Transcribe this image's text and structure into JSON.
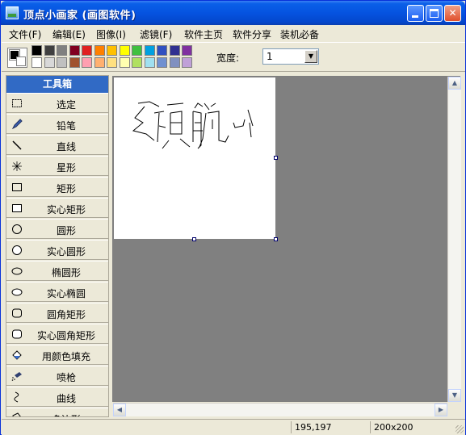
{
  "window": {
    "title": "顶点小画家 (画图软件)"
  },
  "menu": [
    {
      "label": "文件(F)"
    },
    {
      "label": "编辑(E)"
    },
    {
      "label": "图像(I)"
    },
    {
      "label": "滤镜(F)"
    },
    {
      "label": "软件主页"
    },
    {
      "label": "软件分享"
    },
    {
      "label": "装机必备"
    }
  ],
  "toolbar": {
    "foreground_color": "#000000",
    "background_color": "#ffffff",
    "palette_row1": [
      "#000000",
      "#404040",
      "#808080",
      "#800020",
      "#e02020",
      "#ff8000",
      "#ffc000",
      "#ffff00",
      "#40c040",
      "#00a0e0",
      "#3050c0",
      "#303090",
      "#8030a0"
    ],
    "palette_row2": [
      "#ffffff",
      "#d8d8d8",
      "#c0c0c0",
      "#a0522d",
      "#ff9fb0",
      "#ffb070",
      "#ffe080",
      "#ffffb0",
      "#b0e060",
      "#a0e0f0",
      "#7090d0",
      "#8090c0",
      "#c0a0d8"
    ],
    "width_label": "宽度:",
    "width_value": "1"
  },
  "toolbox": {
    "header": "工具箱",
    "tools": [
      {
        "label": "选定",
        "icon": "select-rect-icon"
      },
      {
        "label": "铅笔",
        "icon": "pencil-icon"
      },
      {
        "label": "直线",
        "icon": "line-icon"
      },
      {
        "label": "星形",
        "icon": "star-icon"
      },
      {
        "label": "矩形",
        "icon": "rectangle-icon"
      },
      {
        "label": "实心矩形",
        "icon": "filled-rectangle-icon"
      },
      {
        "label": "圆形",
        "icon": "circle-icon"
      },
      {
        "label": "实心圆形",
        "icon": "filled-circle-icon"
      },
      {
        "label": "椭圆形",
        "icon": "ellipse-icon"
      },
      {
        "label": "实心椭圆",
        "icon": "filled-ellipse-icon"
      },
      {
        "label": "圆角矩形",
        "icon": "rounded-rectangle-icon"
      },
      {
        "label": "实心圆角矩形",
        "icon": "filled-rounded-rectangle-icon"
      },
      {
        "label": "用颜色填充",
        "icon": "paint-bucket-icon"
      },
      {
        "label": "喷枪",
        "icon": "airbrush-icon"
      },
      {
        "label": "曲线",
        "icon": "curve-icon"
      },
      {
        "label": "多边形",
        "icon": "polygon-icon"
      }
    ]
  },
  "status": {
    "coordinates": "195,197",
    "image_size": "200x200"
  }
}
